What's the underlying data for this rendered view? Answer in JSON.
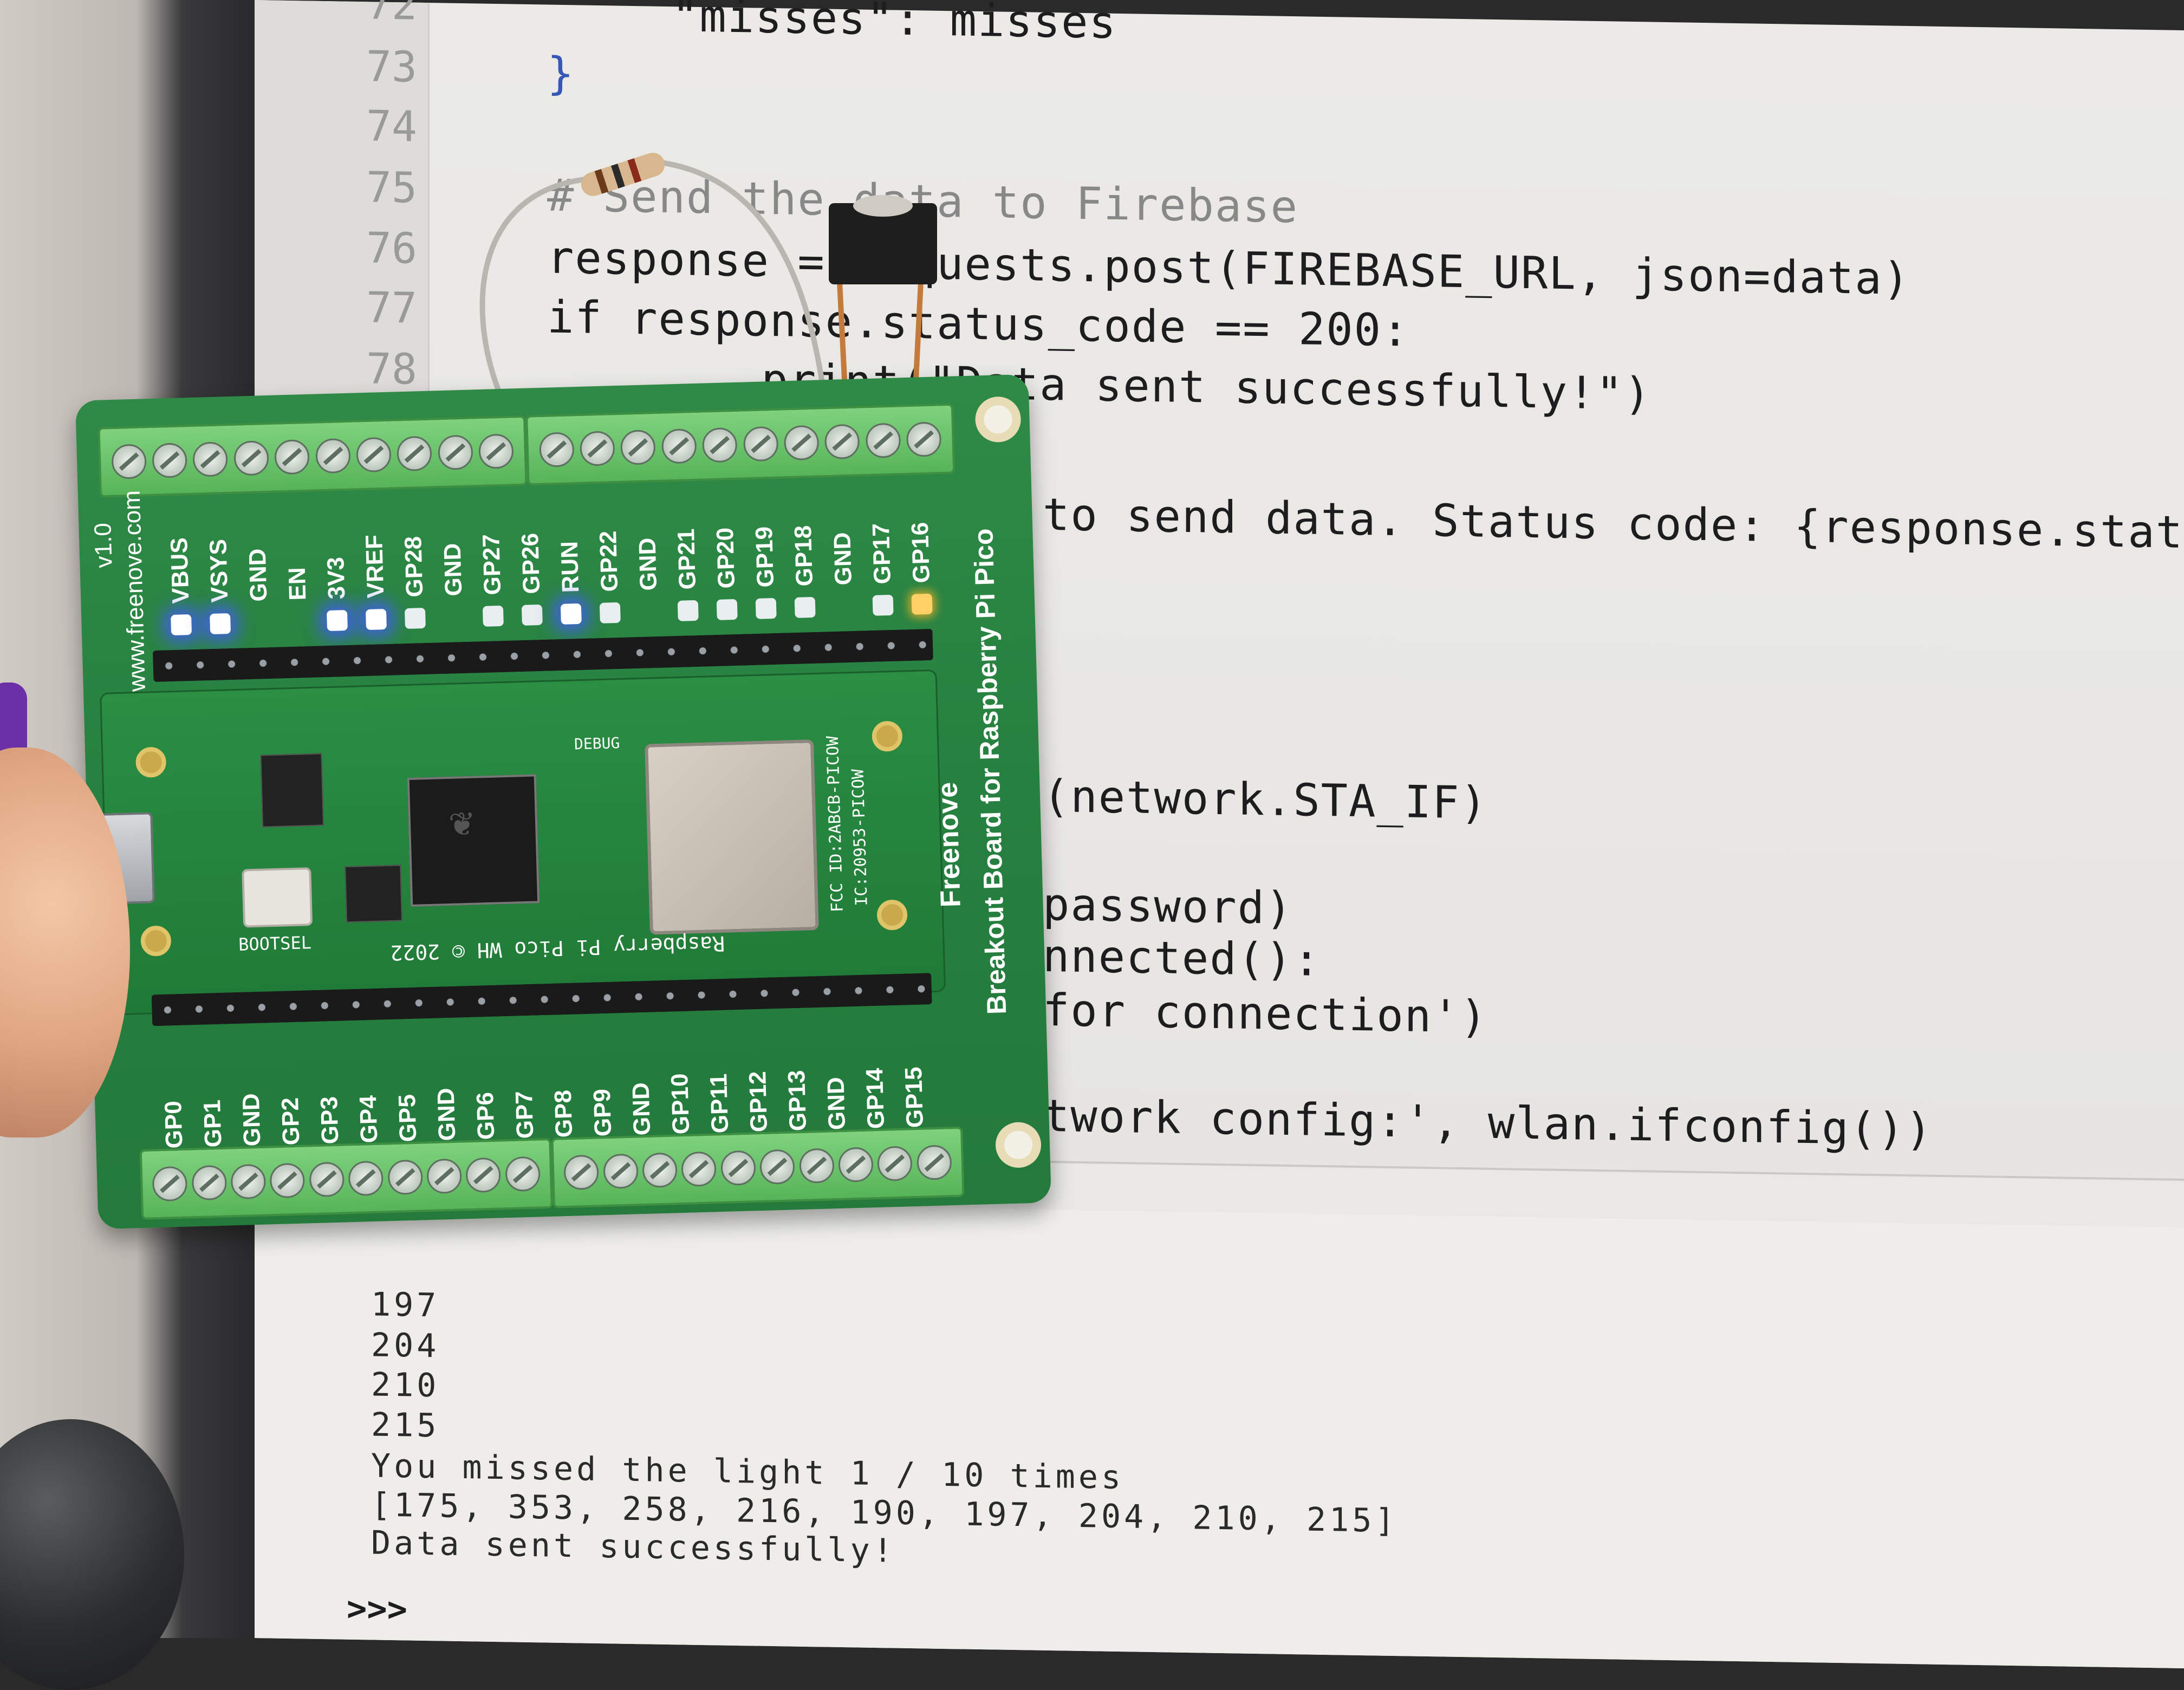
{
  "editor": {
    "line_numbers": [
      "72",
      "73",
      "74",
      "75",
      "76",
      "77",
      "78"
    ],
    "code_lines": [
      "\"misses\": misses",
      "}",
      "# Send the data to Firebase",
      "response = requests.post(FIREBASE_URL, json=data)",
      "if response.status_code == 200:",
      "    print(\"Data sent successfully!\")",
      "to send data. Status code: {response.status_co",
      "(network.STA_IF)",
      "password)",
      "nnected():",
      "for connection')",
      "twork config:', wlan.ifconfig())"
    ]
  },
  "shell": {
    "lines": [
      "197",
      "204",
      "210",
      "215",
      "You missed the light 1 / 10 times",
      "[175, 353, 258, 216, 190, 197, 204, 210, 215]",
      "Data sent successfully!"
    ],
    "prompt": ">>>"
  },
  "board": {
    "side_label": "Breakout Board for Raspberry Pi Pico",
    "brand": "Freenove",
    "url": "www.freenove.com",
    "version": "v1.0",
    "top_pins": [
      "VBUS",
      "VSYS",
      "GND",
      "EN",
      "3V3",
      "VREF",
      "GP28",
      "GND",
      "GP27",
      "GP26",
      "RUN",
      "GP22",
      "GND",
      "GP21",
      "GP20",
      "GP19",
      "GP18",
      "GND",
      "GP17",
      "GP16"
    ],
    "bottom_pins": [
      "GP0",
      "GP1",
      "GND",
      "GP2",
      "GP3",
      "GP4",
      "GP5",
      "GND",
      "GP6",
      "GP7",
      "GP8",
      "GP9",
      "GND",
      "GP10",
      "GP11",
      "GP12",
      "GP13",
      "GND",
      "GP14",
      "GP15"
    ],
    "pico_text": "Raspberry Pi Pico WH © 2022",
    "fcc_text": "FCC ID:2ABCB-PICOW",
    "ic_text": "IC:20953-PICOW",
    "bootsel": "BOOTSEL",
    "debug": "DEBUG"
  },
  "colors": {
    "pcb_green": "#26803f",
    "terminal_green": "#6cc46c",
    "led_blue": "#4a5aff",
    "screen_bg": "#e9e8e4"
  }
}
